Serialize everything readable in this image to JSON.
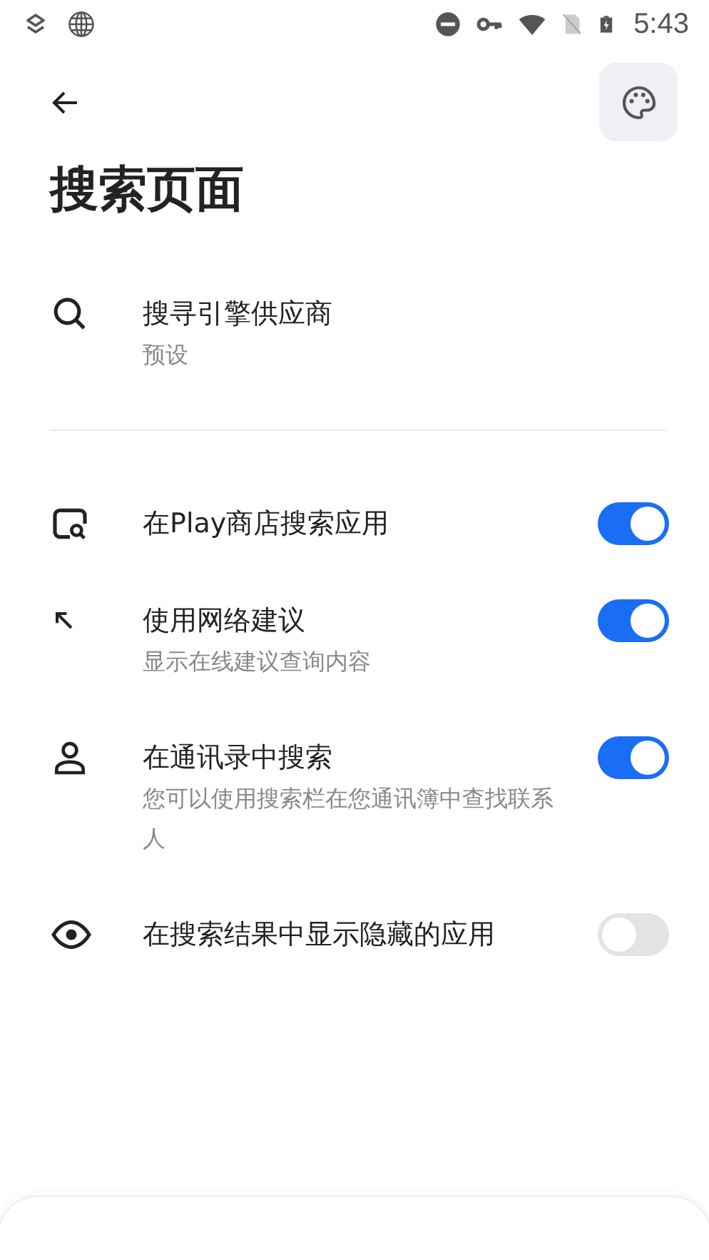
{
  "status_bar": {
    "time": "5:43"
  },
  "title": "搜索页面",
  "sections": [
    {
      "items": [
        {
          "kind": "link",
          "title": "搜寻引擎供应商",
          "subtitle": "预设"
        }
      ]
    },
    {
      "items": [
        {
          "kind": "switch",
          "title": "在Play商店搜索应用",
          "on": true
        },
        {
          "kind": "switch",
          "title": "使用网络建议",
          "subtitle": "显示在线建议查询内容",
          "on": true
        },
        {
          "kind": "switch",
          "title": "在通讯录中搜索",
          "subtitle": "您可以使用搜索栏在您通讯簿中查找联系人",
          "on": true
        },
        {
          "kind": "switch",
          "title": "在搜索结果中显示隐藏的应用",
          "on": false
        }
      ]
    }
  ]
}
